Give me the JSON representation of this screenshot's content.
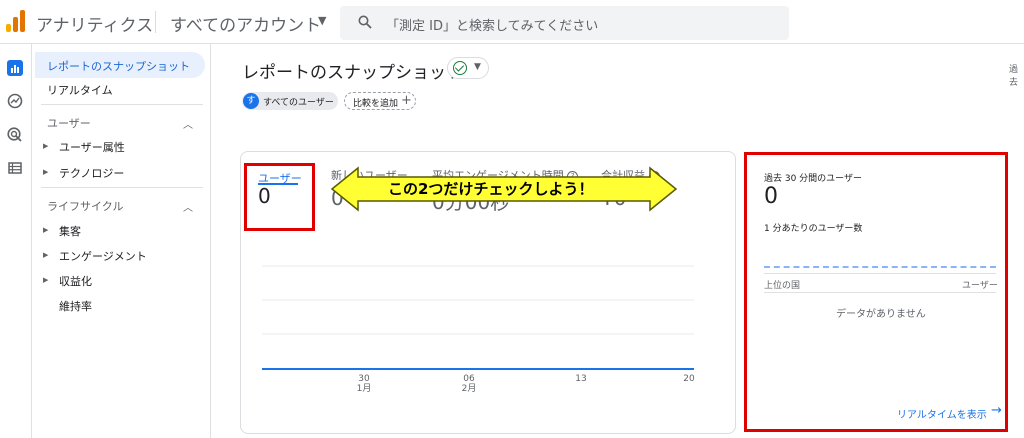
{
  "header": {
    "app_title": "アナリティクス",
    "account": "すべてのアカウント",
    "search_placeholder": "「測定 ID」と検索してみてください"
  },
  "sidebar": {
    "active_item": "レポートのスナップショット",
    "realtime": "リアルタイム",
    "section_users": "ユーザー",
    "user_attributes": "ユーザー属性",
    "technology": "テクノロジー",
    "section_lifecycle": "ライフサイクル",
    "acquisition": "集客",
    "engagement": "エンゲージメント",
    "monetization": "収益化",
    "retention": "維持率"
  },
  "page": {
    "title": "レポートのスナップショット",
    "far_right_text": "過去",
    "chip_all_avatar": "す",
    "chip_all_users": "すべてのユーザー",
    "chip_compare": "比較を追加"
  },
  "overview": {
    "users_label": "ユーザー",
    "users_value": "0",
    "new_users_label": "新しいユーザー",
    "new_users_value": "0",
    "engagement_label": "平均エンゲージメント時間",
    "engagement_value": "0分00秒",
    "revenue_label": "合計収益",
    "revenue_value": "¥0",
    "annotation": "この2つだけチェックしよう！"
  },
  "chart_data": {
    "type": "line",
    "categories": [
      "30",
      "06",
      "13",
      "20"
    ],
    "category_sublabels": [
      "1月",
      "2月",
      "",
      ""
    ],
    "series": [
      {
        "values": [
          0,
          0,
          0,
          0
        ]
      }
    ]
  },
  "realtime": {
    "title": "過去 30 分間のユーザー",
    "value": "0",
    "per_minute": "1 分あたりのユーザー数",
    "col_country": "上位の国",
    "col_users": "ユーザー",
    "empty": "データがありません",
    "link": "リアルタイムを表示"
  },
  "colors": {
    "accent": "#1a73e8",
    "highlight_box": "#e00000",
    "arrow_fill": "#ffff33"
  }
}
